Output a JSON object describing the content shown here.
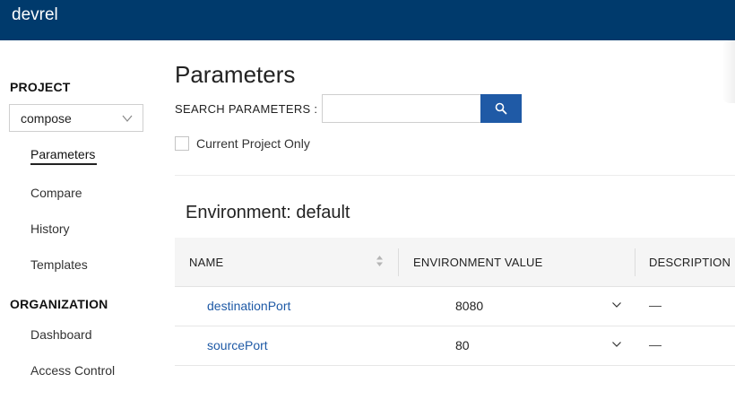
{
  "app": {
    "title": "devrel"
  },
  "sidebar": {
    "project_section": "PROJECT",
    "project_select": {
      "value": "compose"
    },
    "project_items": [
      {
        "label": "Parameters",
        "active": true
      },
      {
        "label": "Compare"
      },
      {
        "label": "History"
      },
      {
        "label": "Templates"
      }
    ],
    "organization_section": "ORGANIZATION",
    "organization_items": [
      {
        "label": "Dashboard"
      },
      {
        "label": "Access Control"
      }
    ]
  },
  "main": {
    "title": "Parameters",
    "search_label": "SEARCH PARAMETERS :",
    "search_value": "",
    "current_project_only_label": "Current Project Only",
    "environment_title": "Environment: default",
    "table": {
      "headers": [
        "NAME",
        "ENVIRONMENT VALUE",
        "DESCRIPTION"
      ],
      "rows": [
        {
          "name": "destinationPort",
          "value": "8080",
          "description": "—"
        },
        {
          "name": "sourcePort",
          "value": "80",
          "description": "—"
        }
      ]
    }
  },
  "colors": {
    "topbar": "#003a6c",
    "accent": "#1f5aa6",
    "link": "#1f5aa6"
  },
  "icons": {
    "project_select": "chevron-down-icon",
    "search": "search-icon",
    "sort": "sort-icon",
    "row_expand": "chevron-down-icon"
  }
}
